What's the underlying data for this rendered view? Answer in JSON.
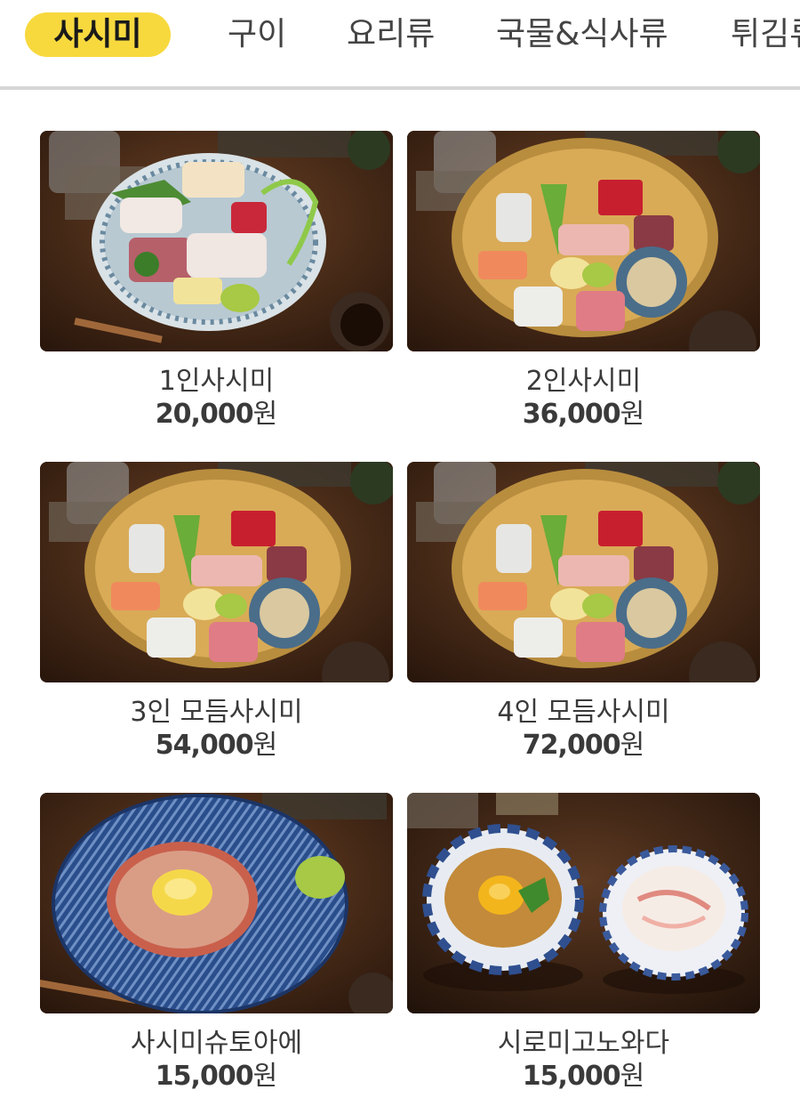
{
  "tabs": [
    {
      "label": "사시미",
      "active": true
    },
    {
      "label": "구이",
      "active": false
    },
    {
      "label": "요리류",
      "active": false
    },
    {
      "label": "국물&식사류",
      "active": false
    },
    {
      "label": "튀김류",
      "active": false
    }
  ],
  "colors": {
    "active_tab": "#f7d93e",
    "divider": "#d6d6d6",
    "text": "#3a3a3a"
  },
  "menu": {
    "items": [
      {
        "name": "1인사시미",
        "price": "20,000",
        "currency": "원",
        "photo": "sashimi-platter-blue-plate"
      },
      {
        "name": "2인사시미",
        "price": "36,000",
        "currency": "원",
        "photo": "sashimi-platter-yellow-plate"
      },
      {
        "name": "3인 모듬사시미",
        "price": "54,000",
        "currency": "원",
        "photo": "sashimi-platter-yellow-plate"
      },
      {
        "name": "4인 모듬사시미",
        "price": "72,000",
        "currency": "원",
        "photo": "sashimi-platter-yellow-plate"
      },
      {
        "name": "사시미슈토아에",
        "price": "15,000",
        "currency": "원",
        "photo": "tartare-with-egg-yolk"
      },
      {
        "name": "시로미고노와다",
        "price": "15,000",
        "currency": "원",
        "photo": "two-bowls-egg-and-fish"
      }
    ]
  }
}
